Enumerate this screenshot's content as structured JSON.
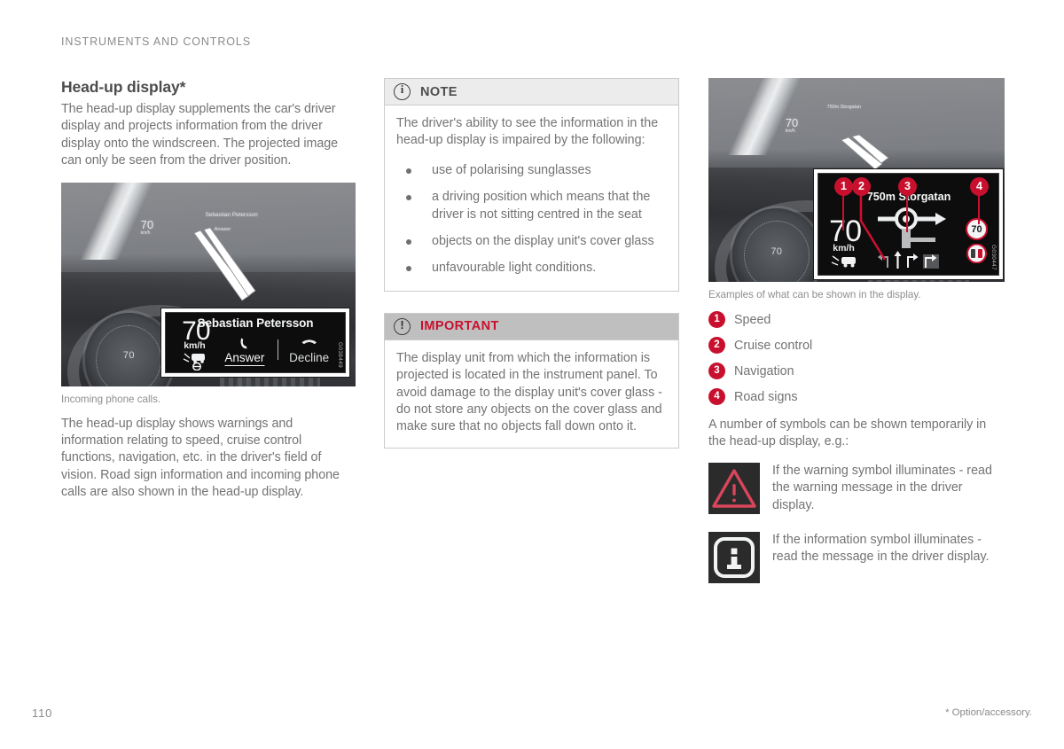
{
  "page": {
    "running_header": "INSTRUMENTS AND CONTROLS",
    "folio": "110",
    "footnote": "* Option/accessory."
  },
  "colors": {
    "accent_red": "#c8102e",
    "body_text": "#737373",
    "heading_text": "#4d4d4d",
    "note_header_bg": "#ececec",
    "important_header_bg": "#bfbfbf",
    "box_border": "#c9cbcd"
  },
  "left_column": {
    "title": "Head-up display*",
    "intro": "The head-up display supplements the car's driver display and projects information from the driver display onto the windscreen. The projected image can only be seen from the driver position.",
    "figure": {
      "caption": "Incoming phone calls.",
      "image_code": "G038449",
      "hud": {
        "speed": "70",
        "speed_unit": "km/h",
        "caller_name": "Sebastian Petersson",
        "answer_label": "Answer",
        "decline_label": "Decline",
        "phone_icon": "phone-handset-icon",
        "decline_icon": "phone-hangup-icon",
        "distance_alert_icon": "distance-warning-icon"
      }
    },
    "outro": "The head-up display shows warnings and information relating to speed, cruise control functions, navigation, etc. in the driver's field of vision. Road sign information and incoming phone calls are also shown in the head-up display."
  },
  "middle_column": {
    "note": {
      "icon": "info-circle-icon",
      "title": "NOTE",
      "intro": "The driver's ability to see the information in the head-up display is impaired by the following:",
      "bullets": [
        "use of polarising sunglasses",
        "a driving position which means that the driver is not sitting centred in the seat",
        "objects on the display unit's cover glass",
        "unfavourable light conditions."
      ]
    },
    "important": {
      "icon": "exclamation-circle-icon",
      "title": "IMPORTANT",
      "body": "The display unit from which the information is projected is located in the instrument panel. To avoid damage to the display unit's cover glass - do not store any objects on the cover glass and make sure that no objects fall down onto it."
    }
  },
  "right_column": {
    "figure": {
      "caption": "Examples of what can be shown in the display.",
      "image_code": "G030447",
      "hud": {
        "speed": "70",
        "speed_unit": "km/h",
        "nav_distance": "750m",
        "nav_street": "Storgatan",
        "road_sign_speed": "70",
        "roundabout_icon": "roundabout-exit-right-icon",
        "lane_guidance_icon": "lane-guidance-icon",
        "cruise_icon": "adaptive-cruise-distance-icon",
        "overtaking_sign_icon": "no-overtaking-sign-icon"
      },
      "callouts": [
        {
          "n": "1",
          "target": "speed"
        },
        {
          "n": "2",
          "target": "cruise-control"
        },
        {
          "n": "3",
          "target": "navigation"
        },
        {
          "n": "4",
          "target": "road-signs"
        }
      ]
    },
    "key_list": [
      {
        "n": "1",
        "label": "Speed"
      },
      {
        "n": "2",
        "label": "Cruise control"
      },
      {
        "n": "3",
        "label": "Navigation"
      },
      {
        "n": "4",
        "label": "Road signs"
      }
    ],
    "symbols_intro": "A number of symbols can be shown temporarily in the head-up display, e.g.:",
    "symbols": [
      {
        "icon": "warning-triangle-icon",
        "text": "If the warning symbol illuminates - read the warning message in the driver display."
      },
      {
        "icon": "information-i-icon",
        "text": "If the information symbol illuminates - read the message in the driver display."
      }
    ]
  }
}
